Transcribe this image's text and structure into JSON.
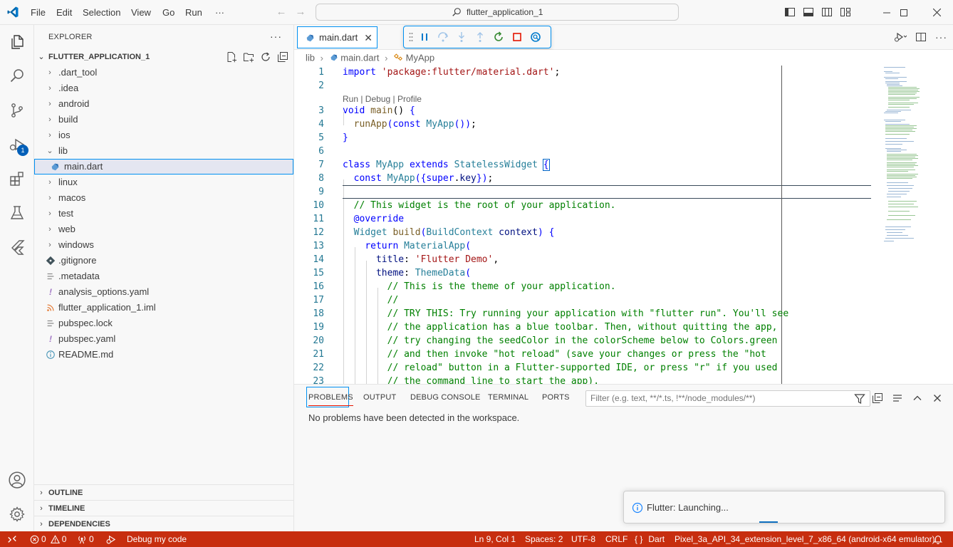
{
  "menu": [
    "File",
    "Edit",
    "Selection",
    "View",
    "Go",
    "Run",
    "···"
  ],
  "command_center": "flutter_application_1",
  "explorer": {
    "title": "EXPLORER",
    "more": "···",
    "root": "FLUTTER_APPLICATION_1",
    "items": [
      {
        "label": ".dart_tool",
        "type": "folder"
      },
      {
        "label": ".idea",
        "type": "folder"
      },
      {
        "label": "android",
        "type": "folder"
      },
      {
        "label": "build",
        "type": "folder"
      },
      {
        "label": "ios",
        "type": "folder"
      },
      {
        "label": "lib",
        "type": "folder-open"
      },
      {
        "label": "main.dart",
        "type": "dart"
      },
      {
        "label": "linux",
        "type": "folder"
      },
      {
        "label": "macos",
        "type": "folder"
      },
      {
        "label": "test",
        "type": "folder"
      },
      {
        "label": "web",
        "type": "folder"
      },
      {
        "label": "windows",
        "type": "folder"
      },
      {
        "label": ".gitignore",
        "type": "git"
      },
      {
        "label": ".metadata",
        "type": "text"
      },
      {
        "label": "analysis_options.yaml",
        "type": "yaml"
      },
      {
        "label": "flutter_application_1.iml",
        "type": "rss"
      },
      {
        "label": "pubspec.lock",
        "type": "text"
      },
      {
        "label": "pubspec.yaml",
        "type": "yaml"
      },
      {
        "label": "README.md",
        "type": "info"
      }
    ],
    "sections": [
      "OUTLINE",
      "TIMELINE",
      "DEPENDENCIES"
    ]
  },
  "activity_badge": "1",
  "editor": {
    "tab_label": "main.dart",
    "breadcrumb": [
      "lib",
      "main.dart",
      "MyApp"
    ],
    "code_lens": "Run | Debug | Profile",
    "line_numbers": [
      "1",
      "2",
      "3",
      "4",
      "5",
      "6",
      "7",
      "8",
      "9",
      "10",
      "11",
      "12",
      "13",
      "14",
      "15",
      "16",
      "17",
      "18",
      "19",
      "20",
      "21",
      "22",
      "23"
    ]
  },
  "panel": {
    "tabs": [
      "PROBLEMS",
      "OUTPUT",
      "DEBUG CONSOLE",
      "TERMINAL",
      "PORTS"
    ],
    "filter_placeholder": "Filter (e.g. text, **/*.ts, !**/node_modules/**)",
    "message": "No problems have been detected in the workspace."
  },
  "notification": "Flutter: Launching...",
  "status": {
    "errors": "0",
    "warnings": "0",
    "ports": "0",
    "debug_label": "Debug my code",
    "position": "Ln 9, Col 1",
    "spaces": "Spaces: 2",
    "encoding": "UTF-8",
    "eol": "CRLF",
    "language": "Dart",
    "device": "Pixel_3a_API_34_extension_level_7_x86_64 (android-x64 emulator)"
  },
  "colors": {
    "accent": "#005fb8",
    "status_bar": "#c72e0f",
    "selection_border": "#0090f1"
  }
}
